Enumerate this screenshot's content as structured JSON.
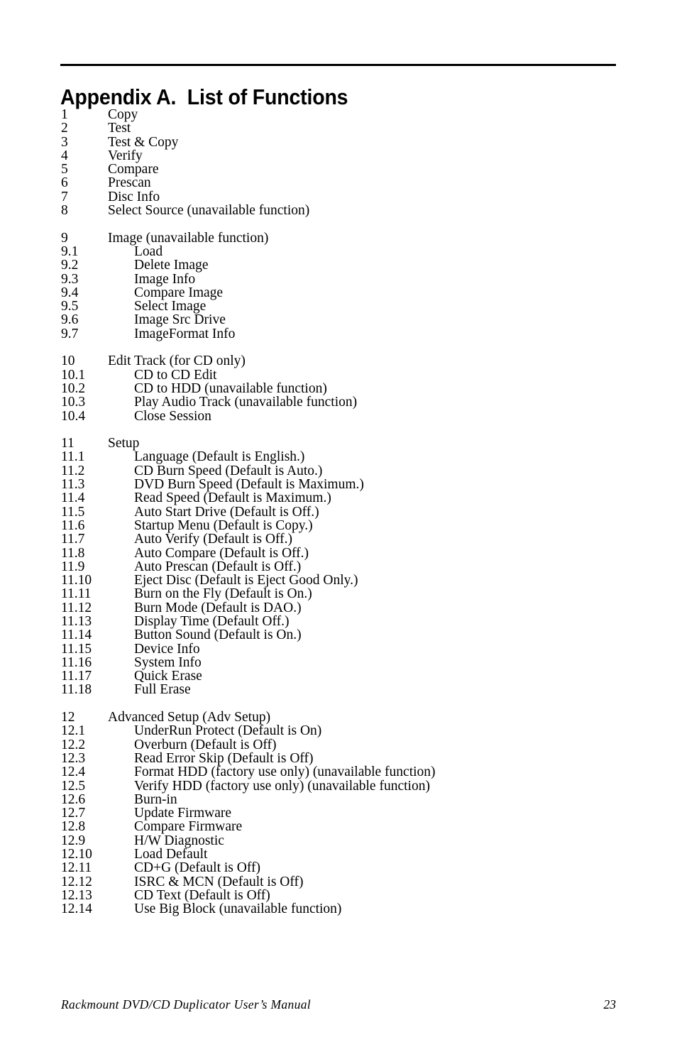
{
  "document": {
    "title": "Appendix A.  List of Functions",
    "footer_text": "Rackmount DVD/CD Duplicator User’s Manual",
    "page_number": "23"
  },
  "groups": [
    {
      "id": "group-basic-functions",
      "rows": [
        {
          "num": "1",
          "label": "Copy",
          "level": 1
        },
        {
          "num": "2",
          "label": "Test",
          "level": 1
        },
        {
          "num": "3",
          "label": "Test & Copy",
          "level": 1
        },
        {
          "num": "4",
          "label": "Verify",
          "level": 1
        },
        {
          "num": "5",
          "label": "Compare",
          "level": 1
        },
        {
          "num": "6",
          "label": "Prescan",
          "level": 1
        },
        {
          "num": "7",
          "label": "Disc Info",
          "level": 1
        },
        {
          "num": "8",
          "label": "Select Source (unavailable function)",
          "level": 1
        }
      ]
    },
    {
      "id": "group-image",
      "rows": [
        {
          "num": "9",
          "label": "Image (unavailable function)",
          "level": 1
        },
        {
          "num": "9.1",
          "label": "Load",
          "level": 2
        },
        {
          "num": "9.2",
          "label": "Delete Image",
          "level": 2
        },
        {
          "num": "9.3",
          "label": "Image Info",
          "level": 2
        },
        {
          "num": "9.4",
          "label": "Compare Image",
          "level": 2
        },
        {
          "num": "9.5",
          "label": "Select Image",
          "level": 2
        },
        {
          "num": "9.6",
          "label": "Image Src Drive",
          "level": 2
        },
        {
          "num": "9.7",
          "label": "ImageFormat Info",
          "level": 2
        }
      ]
    },
    {
      "id": "group-edit-track",
      "rows": [
        {
          "num": "10",
          "label": "Edit Track (for CD only)",
          "level": 1
        },
        {
          "num": "10.1",
          "label": "CD to CD Edit",
          "level": 2
        },
        {
          "num": "10.2",
          "label": "CD to HDD (unavailable function)",
          "level": 2
        },
        {
          "num": "10.3",
          "label": "Play Audio Track (unavailable function)",
          "level": 2
        },
        {
          "num": "10.4",
          "label": "Close Session",
          "level": 2
        }
      ]
    },
    {
      "id": "group-setup",
      "rows": [
        {
          "num": "11",
          "label": "Setup",
          "level": 1
        },
        {
          "num": "11.1",
          "label": "Language (Default is English.)",
          "level": 2
        },
        {
          "num": "11.2",
          "label": "CD Burn Speed (Default is Auto.)",
          "level": 2
        },
        {
          "num": "11.3",
          "label": "DVD Burn Speed (Default is Maximum.)",
          "level": 2
        },
        {
          "num": "11.4",
          "label": "Read Speed (Default is Maximum.)",
          "level": 2
        },
        {
          "num": "11.5",
          "label": "Auto Start Drive (Default is Off.)",
          "level": 2
        },
        {
          "num": "11.6",
          "label": "Startup Menu (Default is Copy.)",
          "level": 2
        },
        {
          "num": "11.7",
          "label": "Auto Verify (Default is Off.)",
          "level": 2
        },
        {
          "num": "11.8",
          "label": "Auto Compare (Default is Off.)",
          "level": 2
        },
        {
          "num": "11.9",
          "label": "Auto Prescan (Default is Off.)",
          "level": 2
        },
        {
          "num": "11.10",
          "label": "Eject Disc (Default is Eject Good Only.)",
          "level": 2
        },
        {
          "num": "11.11",
          "label": "Burn on the Fly (Default is On.)",
          "level": 2
        },
        {
          "num": "11.12",
          "label": "Burn Mode (Default is DAO.)",
          "level": 2
        },
        {
          "num": "11.13",
          "label": "Display Time (Default Off.)",
          "level": 2
        },
        {
          "num": "11.14",
          "label": "Button Sound (Default is On.)",
          "level": 2
        },
        {
          "num": "11.15",
          "label": "Device Info",
          "level": 2
        },
        {
          "num": "11.16",
          "label": "System Info",
          "level": 2
        },
        {
          "num": "11.17",
          "label": "Quick Erase",
          "level": 2
        },
        {
          "num": "11.18",
          "label": "Full Erase",
          "level": 2
        }
      ]
    },
    {
      "id": "group-advanced-setup",
      "rows": [
        {
          "num": "12",
          "label": "Advanced Setup (Adv Setup)",
          "level": 1
        },
        {
          "num": "12.1",
          "label": "UnderRun Protect (Default is On)",
          "level": 2
        },
        {
          "num": "12.2",
          "label": "Overburn (Default is Off)",
          "level": 2
        },
        {
          "num": "12.3",
          "label": "Read Error Skip (Default is Off)",
          "level": 2
        },
        {
          "num": "12.4",
          "label": "Format HDD (factory use only) (unavailable function)",
          "level": 2
        },
        {
          "num": "12.5",
          "label": "Verify HDD (factory use only) (unavailable function)",
          "level": 2
        },
        {
          "num": "12.6",
          "label": "Burn-in",
          "level": 2
        },
        {
          "num": "12.7",
          "label": "Update Firmware",
          "level": 2
        },
        {
          "num": "12.8",
          "label": "Compare Firmware",
          "level": 2
        },
        {
          "num": "12.9",
          "label": "H/W Diagnostic",
          "level": 2
        },
        {
          "num": "12.10",
          "label": "Load Default",
          "level": 2
        },
        {
          "num": "12.11",
          "label": "CD+G (Default is Off)",
          "level": 2
        },
        {
          "num": "12.12",
          "label": "ISRC & MCN (Default is Off)",
          "level": 2
        },
        {
          "num": "12.13",
          "label": "CD Text (Default is Off)",
          "level": 2
        },
        {
          "num": "12.14",
          "label": "Use Big Block (unavailable function)",
          "level": 2
        }
      ]
    }
  ]
}
